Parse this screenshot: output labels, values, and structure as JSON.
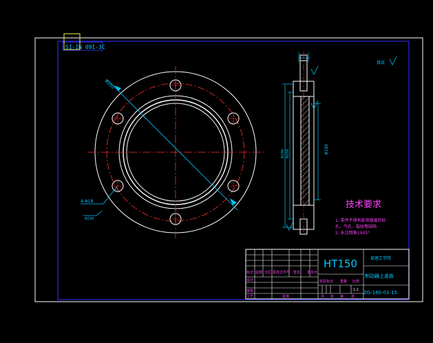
{
  "drawing": {
    "stamp_text": "SI-IN 09I-3C",
    "roughness_note": "其余",
    "tech_title": "技术要求",
    "tech_notes": [
      "1. 零件不得有影响强度的砂",
      "孔、气孔、裂纹等缺陷",
      "2. 未注倒角1X45°"
    ],
    "material": "HT150",
    "school": "某理工学院",
    "part_name": "制动器上盖板",
    "drawing_no": "ZG-160-01-15",
    "scale": "1:1",
    "front_dim_left": "Φ250",
    "front_dim_bottom": "4-Φ18",
    "front_dim_note": "Φ230",
    "side_dims": [
      "Φ290",
      "Φ258"
    ],
    "side_right_dim": "Φ180",
    "title_header_labels": [
      "标记",
      "处数",
      "分区",
      "更改文件号",
      "签名",
      "年月日"
    ],
    "title_left_labels": [
      "设计",
      "审核",
      "工艺"
    ],
    "title_row_labels": [
      "阶段标记",
      "重量",
      "比例"
    ],
    "title_bottom_labels": [
      "共",
      "张",
      "第",
      "张"
    ],
    "approve_label": "批准"
  },
  "colors": {
    "background": "#000000",
    "frame": "#ffffff",
    "inner_frame": "#2020d0",
    "outline": "#ffffff",
    "center_line": "#ff3030",
    "dimension": "#00c8ff",
    "magenta": "#ff40ff",
    "stamp": "#f0f060"
  }
}
